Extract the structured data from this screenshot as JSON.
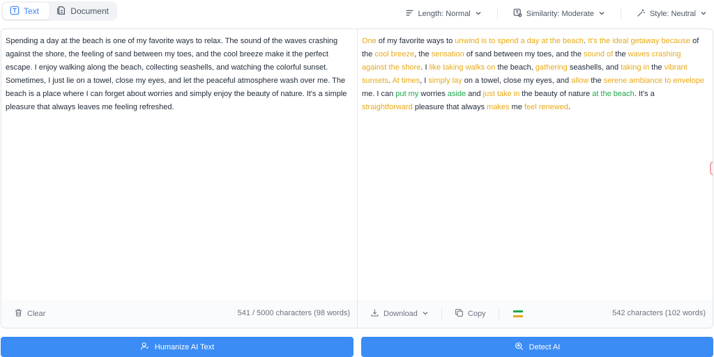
{
  "mode_tabs": [
    {
      "label": "Text",
      "icon": "text-icon",
      "active": true
    },
    {
      "label": "Document",
      "icon": "document-icon",
      "active": false
    }
  ],
  "options": {
    "length": "Length: Normal",
    "similarity": "Similarity: Moderate",
    "style": "Style: Neutral"
  },
  "input": {
    "text": "Spending a day at the beach is one of my favorite ways to relax. The sound of the waves crashing against the shore, the feeling of sand between my toes, and the cool breeze make it the perfect escape. I enjoy walking along the beach, collecting seashells, and watching the colorful sunset. Sometimes, I just lie on a towel, close my eyes, and let the peaceful atmosphere wash over me. The beach is a place where I can forget about worries and simply enjoy the beauty of nature. It's a simple pleasure that always leaves me feeling refreshed.",
    "clear_label": "Clear",
    "count": "541 / 5000 characters (98 words)"
  },
  "output": {
    "segments": [
      {
        "t": "One",
        "c": "y"
      },
      {
        "t": " of my favorite ways to ",
        "c": ""
      },
      {
        "t": "unwind is to spend a day at the beach",
        "c": "y"
      },
      {
        "t": ". ",
        "c": ""
      },
      {
        "t": "It's the ideal getaway because",
        "c": "y"
      },
      {
        "t": " of the ",
        "c": ""
      },
      {
        "t": "cool breeze",
        "c": "y"
      },
      {
        "t": ", the ",
        "c": ""
      },
      {
        "t": "sensation",
        "c": "y"
      },
      {
        "t": " of sand between my toes, and the ",
        "c": ""
      },
      {
        "t": "sound of",
        "c": "y"
      },
      {
        "t": " the ",
        "c": ""
      },
      {
        "t": "waves crashing against the shore",
        "c": "y"
      },
      {
        "t": ". I ",
        "c": ""
      },
      {
        "t": "like taking walks on",
        "c": "y"
      },
      {
        "t": " the beach, ",
        "c": ""
      },
      {
        "t": "gathering",
        "c": "y"
      },
      {
        "t": " seashells, and ",
        "c": ""
      },
      {
        "t": "taking in",
        "c": "y"
      },
      {
        "t": " the ",
        "c": ""
      },
      {
        "t": "vibrant sunsets",
        "c": "y"
      },
      {
        "t": ". ",
        "c": ""
      },
      {
        "t": "At times",
        "c": "y"
      },
      {
        "t": ", I ",
        "c": ""
      },
      {
        "t": "simply lay",
        "c": "y"
      },
      {
        "t": " on a towel, close my eyes, and ",
        "c": ""
      },
      {
        "t": "allow",
        "c": "y"
      },
      {
        "t": " the ",
        "c": ""
      },
      {
        "t": "serene ambiance to envelope",
        "c": "y"
      },
      {
        "t": " me. I can ",
        "c": ""
      },
      {
        "t": "put my",
        "c": "g"
      },
      {
        "t": " worries ",
        "c": ""
      },
      {
        "t": "aside",
        "c": "g"
      },
      {
        "t": " and ",
        "c": ""
      },
      {
        "t": "just take in",
        "c": "y"
      },
      {
        "t": " the beauty of nature ",
        "c": ""
      },
      {
        "t": "at the beach",
        "c": "g"
      },
      {
        "t": ". It's a ",
        "c": ""
      },
      {
        "t": "straightforward",
        "c": "y"
      },
      {
        "t": " pleasure that always ",
        "c": ""
      },
      {
        "t": "makes",
        "c": "y"
      },
      {
        "t": " me ",
        "c": ""
      },
      {
        "t": "feel renewed",
        "c": "y"
      },
      {
        "t": ".",
        "c": ""
      }
    ],
    "download_label": "Download",
    "copy_label": "Copy",
    "count": "542 characters (102 words)"
  },
  "actions": {
    "humanize": "Humanize AI Text",
    "detect": "Detect AI"
  },
  "colors": {
    "accent": "#3b8cf5",
    "changed": "#e8a915",
    "kept": "#1ea84b",
    "flag_top": "#1ea84b",
    "flag_bottom": "#e8a915"
  }
}
